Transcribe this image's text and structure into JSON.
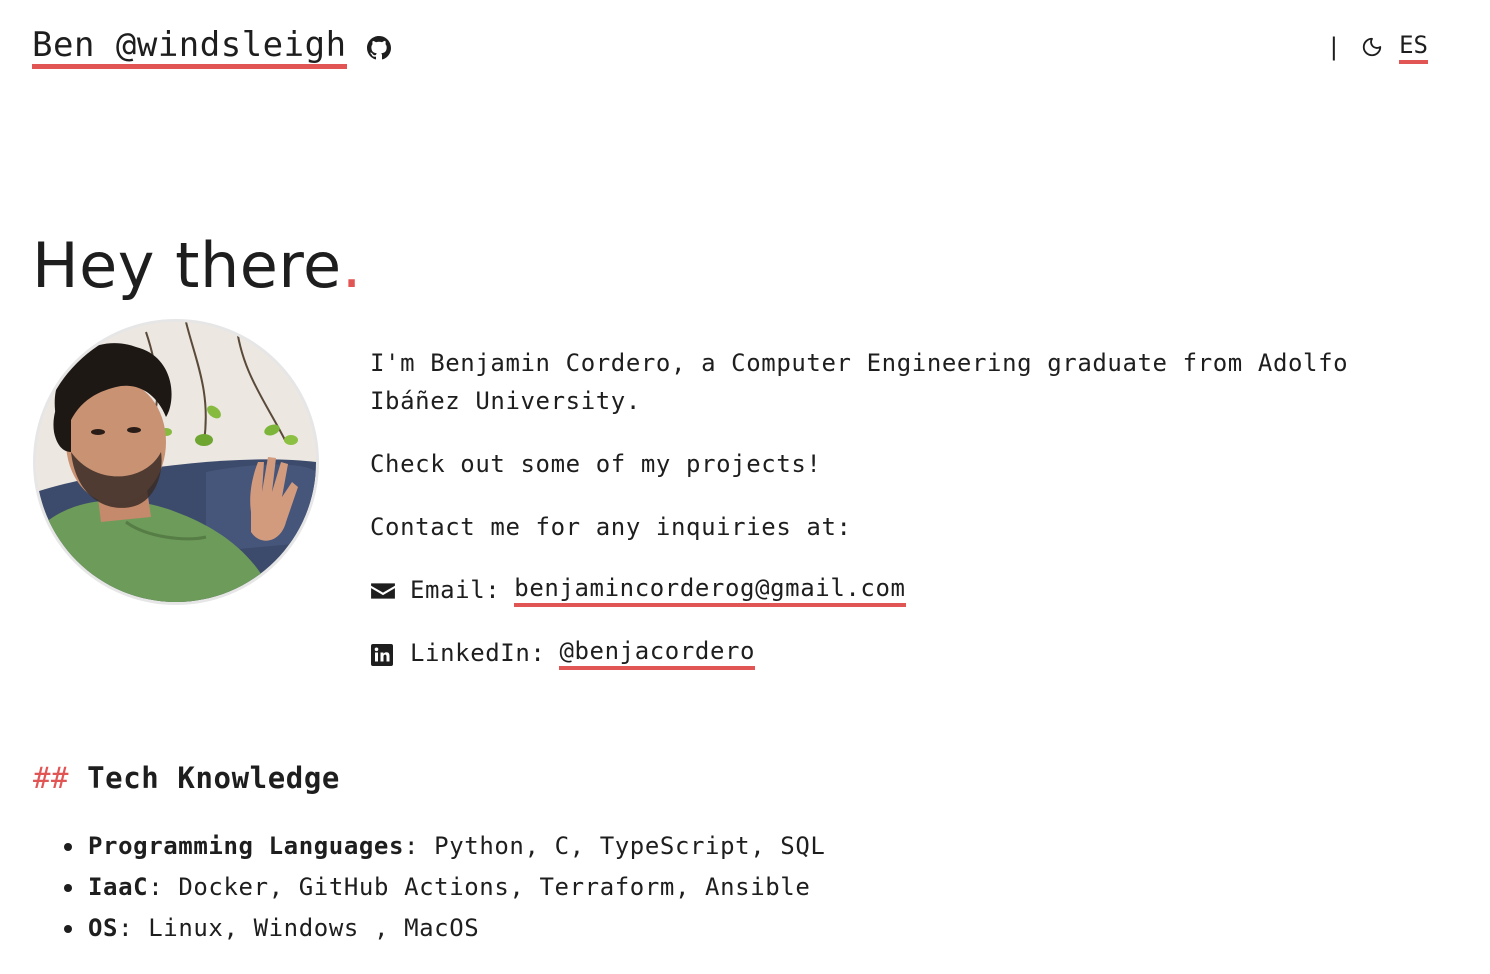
{
  "header": {
    "title": "Ben @windsleigh",
    "separator": "|",
    "language": "ES",
    "github_icon": "github-icon",
    "theme_icon": "moon-icon"
  },
  "hero": {
    "title": "Hey there",
    "dot": "."
  },
  "intro": {
    "line1": "I'm Benjamin Cordero, a Computer Engineering graduate from Adolfo Ibáñez University.",
    "line2": "Check out some of my projects!",
    "line3": "Contact me for any inquiries at:",
    "email_label": "Email:",
    "email_value": "benjamincorderog@gmail.com",
    "email_icon": "envelope-icon",
    "linkedin_label": "LinkedIn:",
    "linkedin_value": "@benjacordero",
    "linkedin_icon": "linkedin-icon"
  },
  "tech": {
    "hash": "##",
    "title": "Tech Knowledge",
    "items": [
      {
        "label": "Programming Languages",
        "sep": ":",
        "value": "Python, C, TypeScript, SQL"
      },
      {
        "label": "IaaC",
        "sep": ":",
        "value": "Docker, GitHub Actions, Terraform, Ansible"
      },
      {
        "label": "OS",
        "sep": ":",
        "value": "Linux, Windows , MacOS"
      }
    ]
  },
  "colors": {
    "accent": "#e25555",
    "text": "#1e1e1e",
    "background": "#ffffff"
  }
}
